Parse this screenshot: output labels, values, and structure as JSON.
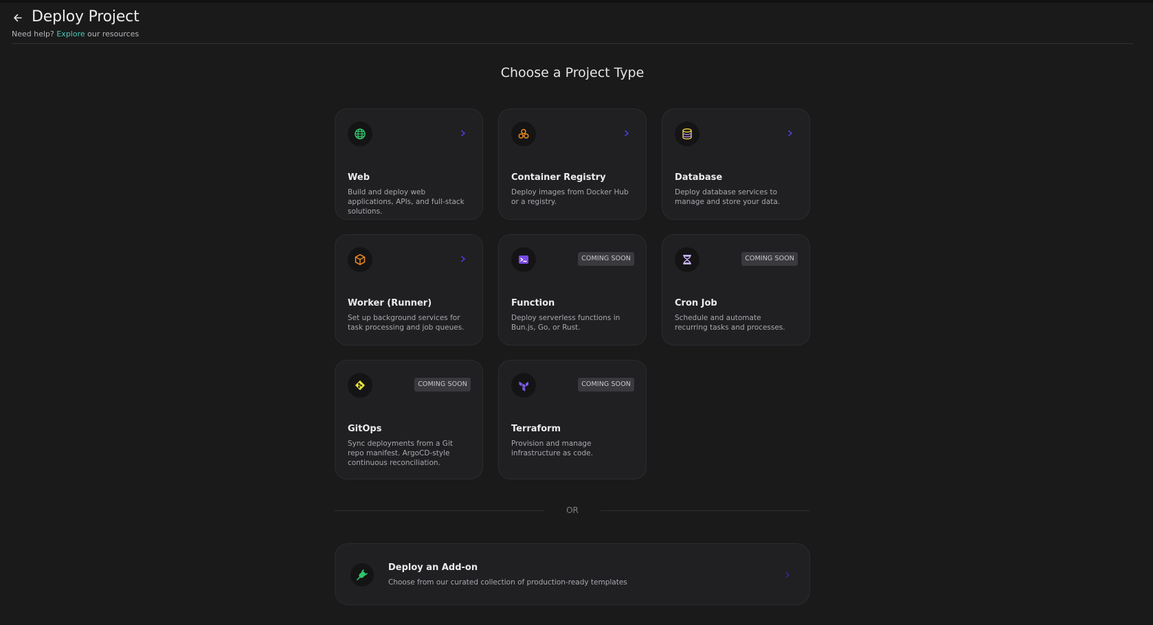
{
  "header": {
    "title": "Deploy Project",
    "help_prefix": "Need help?",
    "help_link": "Explore",
    "help_suffix": "our resources"
  },
  "section_title": "Choose a Project Type",
  "colors": {
    "background": "#1a1a1b",
    "card": "#202023",
    "accent_link": "#4fc6b6",
    "chevron": "#4b3fd6"
  },
  "cards": [
    {
      "title": "Web",
      "desc": "Build and deploy web applications, APIs, and full-stack solutions.",
      "icon": "globe-icon",
      "icon_color": "#34c26b",
      "status": "arrow"
    },
    {
      "title": "Container Registry",
      "desc": "Deploy images from Docker Hub or a registry.",
      "icon": "containers-icon",
      "icon_color": "#f08a24",
      "status": "arrow"
    },
    {
      "title": "Database",
      "desc": "Deploy database services to manage and store your data.",
      "icon": "database-icon",
      "icon_color": "#f2d54a",
      "status": "arrow"
    },
    {
      "title": "Worker (Runner)",
      "desc": "Set up background services for task processing and job queues.",
      "icon": "box-icon",
      "icon_color": "#f08a24",
      "status": "arrow"
    },
    {
      "title": "Function",
      "desc": "Deploy serverless functions in Bun.js, Go, or Rust.",
      "icon": "terminal-icon",
      "icon_color": "#7a4ae6",
      "status": "COMING SOON"
    },
    {
      "title": "Cron Job",
      "desc": "Schedule and automate recurring tasks and processes.",
      "icon": "hourglass-icon",
      "icon_color": "#c6b3f5",
      "status": "COMING SOON"
    },
    {
      "title": "GitOps",
      "desc": "Sync deployments from a Git repo manifest. ArgoCD-style continuous reconciliation.",
      "icon": "git-icon",
      "icon_color": "#e7df3f",
      "status": "COMING SOON"
    },
    {
      "title": "Terraform",
      "desc": "Provision and manage infrastructure as code.",
      "icon": "terraform-icon",
      "icon_color": "#7c5ce8",
      "status": "COMING SOON"
    }
  ],
  "divider_text": "OR",
  "addon": {
    "title": "Deploy an Add-on",
    "desc": "Choose from our curated collection of production-ready templates",
    "icon": "plug-icon",
    "icon_color": "#34c26b"
  }
}
